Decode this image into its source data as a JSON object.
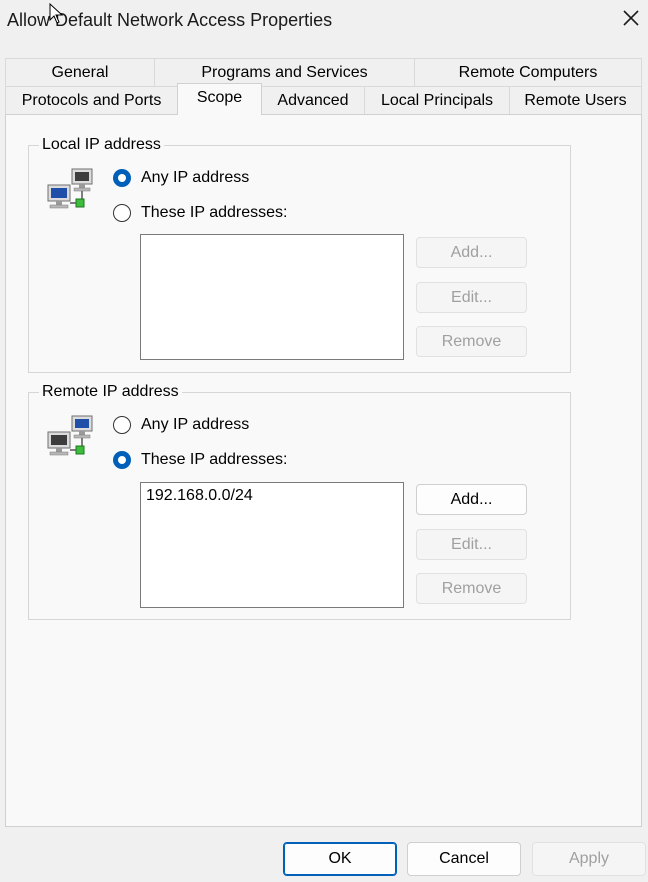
{
  "window": {
    "title": "Allow Default Network Access Properties",
    "close_icon": "close-icon"
  },
  "tabs_row1": [
    {
      "label": "General"
    },
    {
      "label": "Programs and Services"
    },
    {
      "label": "Remote Computers"
    }
  ],
  "tabs_row2": [
    {
      "label": "Protocols and Ports"
    },
    {
      "label": "Scope",
      "active": true
    },
    {
      "label": "Advanced"
    },
    {
      "label": "Local Principals"
    },
    {
      "label": "Remote Users"
    }
  ],
  "local_ip": {
    "group_label": "Local IP address",
    "icon": "network-computers-icon",
    "any_label": "Any IP address",
    "these_label": "These IP addresses:",
    "selected": "any",
    "addresses": [],
    "add_label": "Add...",
    "edit_label": "Edit...",
    "remove_label": "Remove"
  },
  "remote_ip": {
    "group_label": "Remote IP address",
    "icon": "network-computers-icon",
    "any_label": "Any IP address",
    "these_label": "These IP addresses:",
    "selected": "these",
    "addresses": [
      "192.168.0.0/24"
    ],
    "add_label": "Add...",
    "edit_label": "Edit...",
    "remove_label": "Remove"
  },
  "footer": {
    "ok_label": "OK",
    "cancel_label": "Cancel",
    "apply_label": "Apply"
  },
  "colors": {
    "accent": "#005fb8",
    "disabled_text": "#a0a0a0"
  }
}
